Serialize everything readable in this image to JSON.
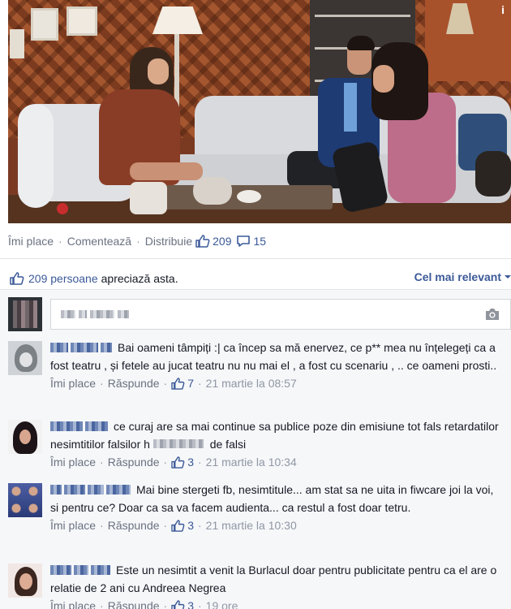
{
  "post": {
    "logo_text": "i",
    "actions": {
      "like": "Îmi place",
      "comment": "Comentează",
      "share": "Distribuie",
      "like_count": "209",
      "comment_count": "15"
    },
    "likes_summary": {
      "count_text": "209 persoane",
      "suffix": "apreciază asta."
    },
    "sort": {
      "label": "Cel mai relevant"
    },
    "write_comment": {
      "placeholder": ""
    }
  },
  "comments": [
    {
      "text": "Bai oameni tâmpiți :| ca încep sa mă enervez, ce p** mea nu înțelegeți ca a fost teatru , și fetele au jucat teatru nu nu mai el , a fost cu scenariu , .. ce oameni prosti..",
      "like_label": "Îmi place",
      "reply_label": "Răspunde",
      "likes": "7",
      "time": "21 martie la 08:57"
    },
    {
      "text": "ce curaj are sa mai continue sa publice poze din emisiune tot fals retardatilor nesimtitilor falsilor h",
      "text_after": "de falsi",
      "like_label": "Îmi place",
      "reply_label": "Răspunde",
      "likes": "3",
      "time": "21 martie la 10:34"
    },
    {
      "text": "Mai bine stergeti fb, nesimtitule... am stat sa ne uita in fiwcare joi la voi, si pentru ce? Doar ca sa va facem audienta... ca restul a fost doar tetru.",
      "like_label": "Îmi place",
      "reply_label": "Răspunde",
      "likes": "3",
      "time": "21 martie la 10:30"
    },
    {
      "text": "Este un nesimtit a venit la Burlacul doar pentru publicitate pentru ca el are o relatie de 2 ani cu Andreea Negrea",
      "like_label": "Îmi place",
      "reply_label": "Răspunde",
      "likes": "3",
      "time": "19 ore"
    }
  ],
  "colors": {
    "link_blue": "#3b5998",
    "meta_gray": "#6a7180",
    "section_bg": "#f6f7f9"
  },
  "icons": [
    "thumbs-up-icon",
    "speech-bubble-icon",
    "camera-icon",
    "chevron-down-icon"
  ]
}
